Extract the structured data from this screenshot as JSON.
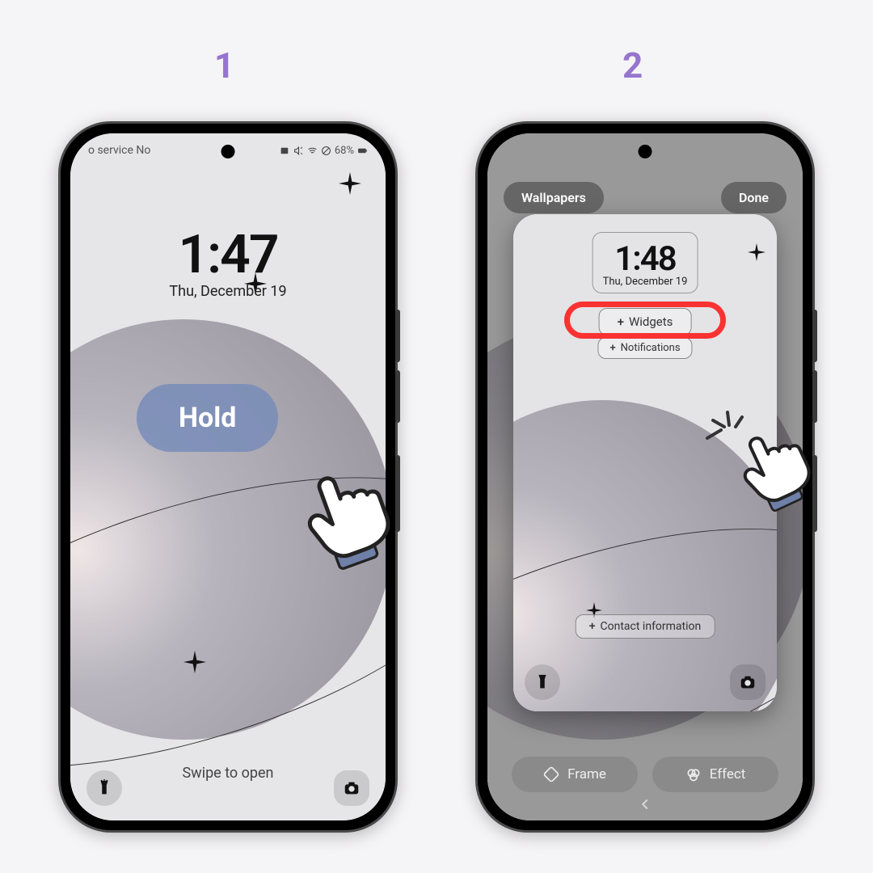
{
  "step_labels": {
    "one": "1",
    "two": "2"
  },
  "phoneA": {
    "status": {
      "left": "o service    No",
      "battery": "68%"
    },
    "clock": {
      "time": "1:47",
      "date": "Thu, December 19"
    },
    "swipe": "Swipe to open",
    "hold_label": "Hold"
  },
  "phoneB": {
    "top": {
      "wallpapers": "Wallpapers",
      "done": "Done"
    },
    "clock": {
      "time": "1:48",
      "date": "Thu, December 19"
    },
    "slots": {
      "widgets": "Widgets",
      "notifications": "Notifications",
      "contact": "Contact information"
    },
    "bottom": {
      "frame": "Frame",
      "effect": "Effect"
    }
  }
}
